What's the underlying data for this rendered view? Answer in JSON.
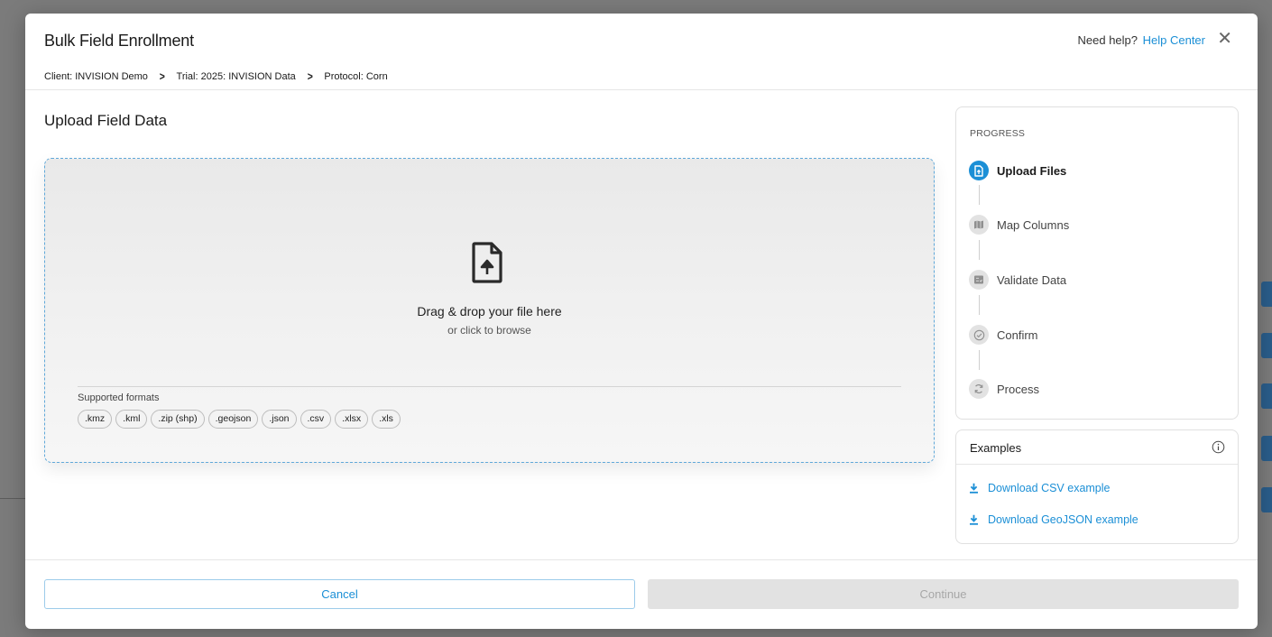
{
  "modal": {
    "title": "Bulk Field Enrollment",
    "help_prefix": "Need help?",
    "help_link": "Help Center",
    "close_label": "✕"
  },
  "breadcrumb": [
    "Client: INVISION Demo",
    "Trial: 2025: INVISION Data",
    "Protocol: Corn"
  ],
  "upload": {
    "section_title": "Upload Field Data",
    "drop_title": "Drag & drop your file here",
    "drop_subtitle": "or click to browse",
    "formats_label": "Supported formats",
    "formats": [
      ".kmz",
      ".kml",
      ".zip (shp)",
      ".geojson",
      ".json",
      ".csv",
      ".xlsx",
      ".xls"
    ]
  },
  "progress": {
    "label": "PROGRESS",
    "steps": [
      {
        "label": "Upload Files",
        "icon": "upload-file-icon",
        "active": true
      },
      {
        "label": "Map Columns",
        "icon": "map-icon",
        "active": false
      },
      {
        "label": "Validate Data",
        "icon": "checklist-icon",
        "active": false
      },
      {
        "label": "Confirm",
        "icon": "check-circle-icon",
        "active": false
      },
      {
        "label": "Process",
        "icon": "sync-icon",
        "active": false
      }
    ]
  },
  "examples": {
    "title": "Examples",
    "links": [
      "Download CSV example",
      "Download GeoJSON example"
    ]
  },
  "footer": {
    "cancel_label": "Cancel",
    "continue_label": "Continue"
  },
  "colors": {
    "accent": "#1b8fd6",
    "overlay": "#7b7b7b",
    "disabled": "#e2e2e2"
  }
}
